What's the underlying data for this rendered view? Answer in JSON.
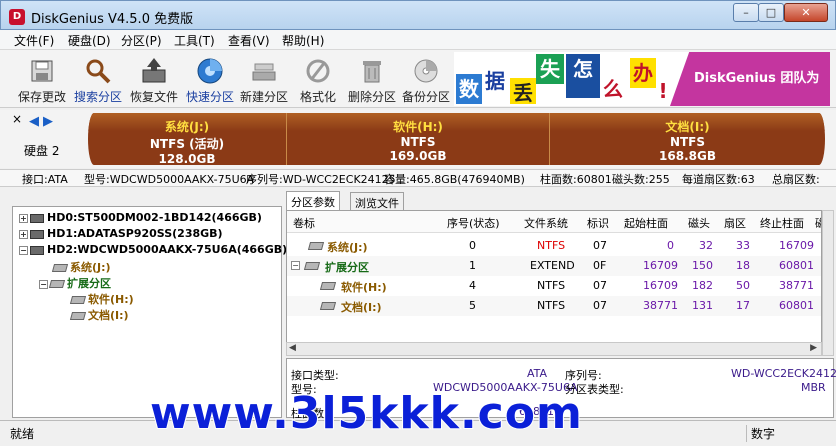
{
  "window": {
    "title": "DiskGenius V4.5.0 免费版",
    "min": "–",
    "max": "□",
    "close": "✕"
  },
  "menu": [
    "文件(F)",
    "硬盘(D)",
    "分区(P)",
    "工具(T)",
    "查看(V)",
    "帮助(H)"
  ],
  "toolbar": [
    {
      "label": "保存更改",
      "icon": "save-icon"
    },
    {
      "label": "搜索分区",
      "icon": "search-icon"
    },
    {
      "label": "恢复文件",
      "icon": "restore-icon"
    },
    {
      "label": "快速分区",
      "icon": "quick-partition-icon"
    },
    {
      "label": "新建分区",
      "icon": "new-partition-icon"
    },
    {
      "label": "格式化",
      "icon": "format-icon"
    },
    {
      "label": "删除分区",
      "icon": "delete-icon"
    },
    {
      "label": "备份分区",
      "icon": "backup-icon"
    }
  ],
  "banner": {
    "chars": [
      "数",
      "据",
      "丢",
      "失",
      "怎",
      "么",
      "办",
      "!"
    ],
    "slogan": "DiskGenius 团队为您"
  },
  "diskbar": {
    "label": "硬盘 2",
    "close": "×",
    "partitions": [
      {
        "name": "系统(J:)",
        "fs": "NTFS (活动)",
        "size": "128.0GB"
      },
      {
        "name": "软件(H:)",
        "fs": "NTFS",
        "size": "169.0GB"
      },
      {
        "name": "文档(I:)",
        "fs": "NTFS",
        "size": "168.8GB"
      }
    ]
  },
  "diskinfo": {
    "interface": "接口:ATA",
    "model": "型号:WDCWD5000AAKX-75U6A",
    "serial": "序列号:WD-WCC2ECK24125",
    "capacity": "容量:465.8GB(476940MB)",
    "cylinders": "柱面数:60801",
    "heads": "磁头数:255",
    "sectors": "每道扇区数:63",
    "total": "总扇区数:"
  },
  "tree": {
    "disks": [
      "HD0:ST500DM002-1BD142(466GB)",
      "HD1:ADATASP920SS(238GB)",
      "HD2:WDCWD5000AAKX-75U6A(466GB)"
    ],
    "system": "系统(J:)",
    "extended": "扩展分区",
    "software": "软件(H:)",
    "documents": "文档(I:)"
  },
  "tabs": [
    "分区参数",
    "浏览文件"
  ],
  "table": {
    "headers": [
      "卷标",
      "序号(状态)",
      "文件系统",
      "标识",
      "起始柱面",
      "磁头",
      "扇区",
      "终止柱面",
      "磁"
    ],
    "rows": [
      {
        "name": "系统(J:)",
        "index": "0",
        "fs": "NTFS",
        "id": "07",
        "start": "0",
        "head": "32",
        "sector": "33",
        "end": "16709"
      },
      {
        "name": "扩展分区",
        "index": "1",
        "fs": "EXTEND",
        "id": "0F",
        "start": "16709",
        "head": "150",
        "sector": "18",
        "end": "60801"
      },
      {
        "name": "软件(H:)",
        "index": "4",
        "fs": "NTFS",
        "id": "07",
        "start": "16709",
        "head": "182",
        "sector": "50",
        "end": "38771"
      },
      {
        "name": "文档(I:)",
        "index": "5",
        "fs": "NTFS",
        "id": "07",
        "start": "38771",
        "head": "131",
        "sector": "17",
        "end": "60801"
      }
    ]
  },
  "detail": {
    "iface_label": "接口类型:",
    "iface_value": "ATA",
    "serial_label": "序列号:",
    "serial_value": "WD-WCC2ECK24125",
    "model_label": "型号:",
    "model_value": "WDCWD5000AAKX-75U6A",
    "pt_label": "分区表类型:",
    "pt_value": "MBR",
    "cyl_label": "柱面数:",
    "cyl_value": "60801"
  },
  "status": {
    "left": "就绪",
    "numlock": "数字"
  },
  "watermark": "www.3l5kkk.com"
}
